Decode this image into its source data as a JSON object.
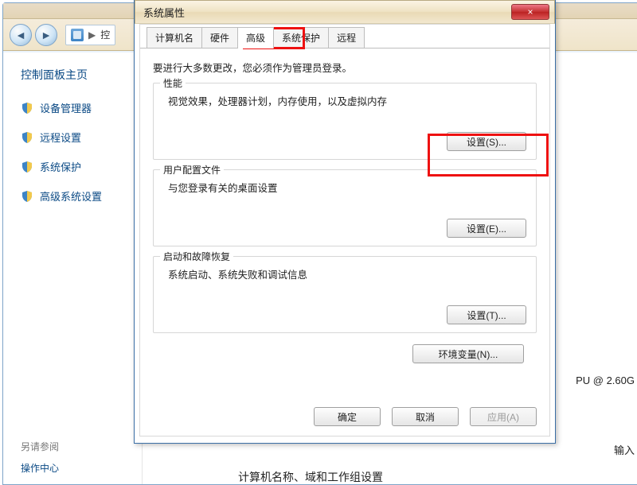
{
  "breadcrumb": {
    "label": "控"
  },
  "sidebar": {
    "title": "控制面板主页",
    "items": [
      {
        "label": "设备管理器"
      },
      {
        "label": "远程设置"
      },
      {
        "label": "系统保护"
      },
      {
        "label": "高级系统设置"
      }
    ],
    "footer_muted": "另请参阅",
    "footer_link": "操作中心"
  },
  "right_fragments": {
    "cpu": "PU @ 2.60G",
    "input": "输入"
  },
  "main_bottom": "计算机名称、域和工作组设置",
  "dialog": {
    "title": "系统属性",
    "close": "×",
    "tabs": [
      "计算机名",
      "硬件",
      "高级",
      "系统保护",
      "远程"
    ],
    "active_tab_index": 2,
    "instruction": "要进行大多数更改，您必须作为管理员登录。",
    "groups": {
      "performance": {
        "legend": "性能",
        "desc": "视觉效果，处理器计划，内存使用，以及虚拟内存",
        "button": "设置(S)..."
      },
      "profile": {
        "legend": "用户配置文件",
        "desc": "与您登录有关的桌面设置",
        "button": "设置(E)..."
      },
      "startup": {
        "legend": "启动和故障恢复",
        "desc": "系统启动、系统失败和调试信息",
        "button": "设置(T)..."
      }
    },
    "env_button": "环境变量(N)...",
    "buttons": {
      "ok": "确定",
      "cancel": "取消",
      "apply": "应用(A)"
    }
  }
}
